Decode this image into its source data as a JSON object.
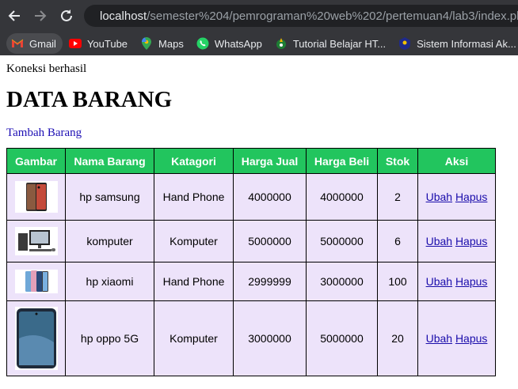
{
  "browser": {
    "url_host": "localhost",
    "url_path": "/semester%204/pemrograman%20web%202/pertemuan4/lab3/index.php",
    "bookmarks": [
      {
        "label": "Gmail",
        "icon": "gmail-icon"
      },
      {
        "label": "YouTube",
        "icon": "youtube-icon"
      },
      {
        "label": "Maps",
        "icon": "maps-icon"
      },
      {
        "label": "WhatsApp",
        "icon": "whatsapp-icon"
      },
      {
        "label": "Tutorial Belajar HT...",
        "icon": "tutorial-icon"
      },
      {
        "label": "Sistem Informasi Ak...",
        "icon": "sistem-icon"
      }
    ]
  },
  "page": {
    "status": "Koneksi berhasil",
    "title": "DATA BARANG",
    "add_link": "Tambah Barang"
  },
  "table": {
    "headers": [
      "Gambar",
      "Nama Barang",
      "Katagori",
      "Harga Jual",
      "Harga Beli",
      "Stok",
      "Aksi"
    ],
    "edit_label": "Ubah",
    "delete_label": "Hapus",
    "rows": [
      {
        "image": "phone-samsung",
        "name": "hp samsung",
        "category": "Hand Phone",
        "sell": "4000000",
        "buy": "4000000",
        "stock": "2"
      },
      {
        "image": "computer",
        "name": "komputer",
        "category": "Komputer",
        "sell": "5000000",
        "buy": "5000000",
        "stock": "6"
      },
      {
        "image": "phone-xiaomi",
        "name": "hp xiaomi",
        "category": "Hand Phone",
        "sell": "2999999",
        "buy": "3000000",
        "stock": "100"
      },
      {
        "image": "phone-oppo",
        "name": "hp oppo 5G",
        "category": "Komputer",
        "sell": "3000000",
        "buy": "5000000",
        "stock": "20"
      }
    ]
  },
  "colors": {
    "header_bg": "#22c55e",
    "cell_bg": "#ede3fa",
    "chrome_bg": "#35363a"
  }
}
